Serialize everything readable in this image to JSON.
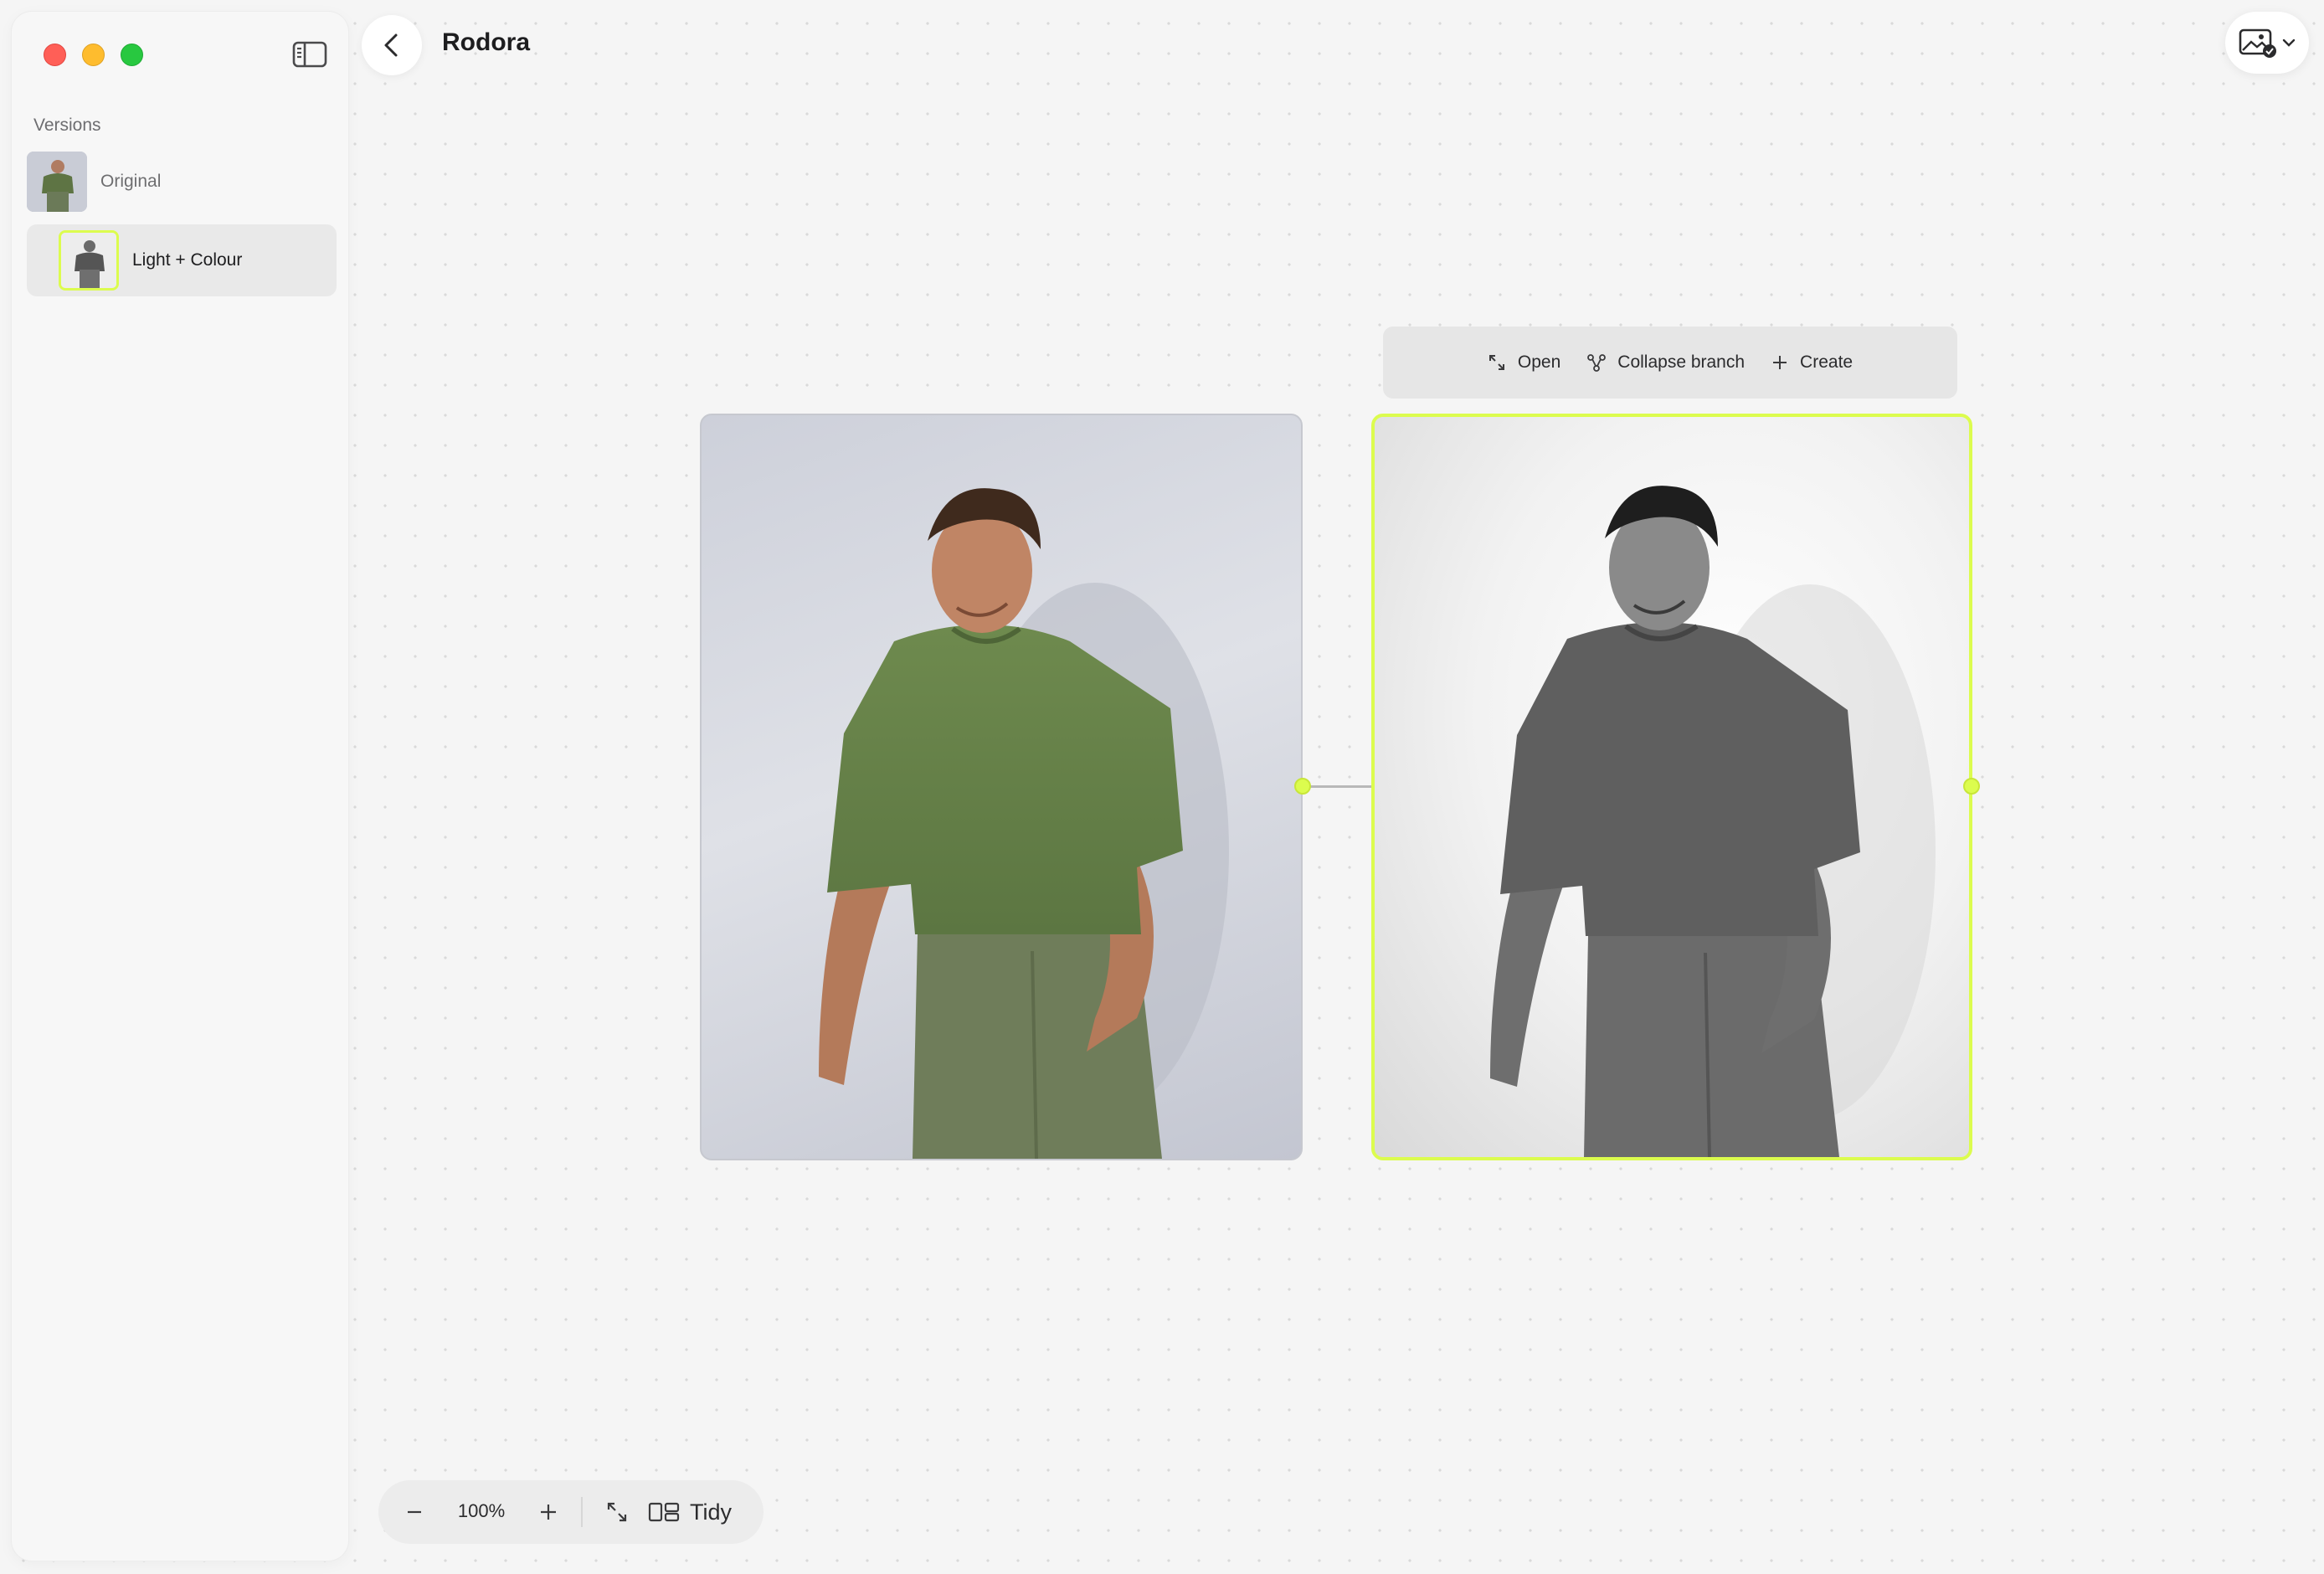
{
  "window": {
    "title": "Rodora"
  },
  "sidebar": {
    "section_title": "Versions",
    "items": [
      {
        "label": "Original",
        "selected": false
      },
      {
        "label": "Light + Colour",
        "selected": true
      }
    ]
  },
  "node_toolbar": {
    "open_label": "Open",
    "collapse_label": "Collapse branch",
    "create_label": "Create"
  },
  "zoom_toolbar": {
    "zoom_level": "100%",
    "tidy_label": "Tidy"
  },
  "colors": {
    "accent": "#dcfc4e",
    "canvas_bg": "#f5f5f5",
    "sidebar_bg": "#f7f7f7",
    "traffic_red": "#ff5f57",
    "traffic_yellow": "#febc2e",
    "traffic_green": "#28c840"
  },
  "icons": {
    "sidebar_toggle": "sidebar-toggle-icon",
    "back": "chevron-left-icon",
    "image_menu": "image-check-icon",
    "open": "expand-arrows-icon",
    "collapse": "branch-icon",
    "create": "plus-icon",
    "zoom_out": "minus-icon",
    "zoom_in": "plus-icon",
    "fit": "fit-screen-icon",
    "tidy": "layout-icon"
  }
}
